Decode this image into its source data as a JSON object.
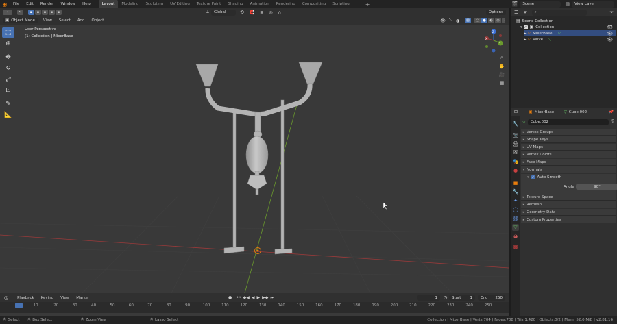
{
  "topbar": {
    "menus": [
      "File",
      "Edit",
      "Render",
      "Window",
      "Help"
    ],
    "workspaces": [
      "Layout",
      "Modeling",
      "Sculpting",
      "UV Editing",
      "Texture Paint",
      "Shading",
      "Animation",
      "Rendering",
      "Compositing",
      "Scripting"
    ],
    "active_workspace": "Layout",
    "scene": "Scene",
    "view_layer": "View Layer"
  },
  "viewport_header": {
    "orientation": "Global",
    "options": "Options"
  },
  "tool_header": {
    "mode": "Object Mode",
    "menus": [
      "View",
      "Select",
      "Add",
      "Object"
    ]
  },
  "viewport": {
    "overlay_title": "User Perspective",
    "overlay_sub": "(1) Collection | MixerBase",
    "axis_labels": {
      "x": "X",
      "y": "Y",
      "z": "Z"
    }
  },
  "outliner": {
    "root": "Scene Collection",
    "collection": "Collection",
    "objects": [
      "MixerBase",
      "Valve"
    ]
  },
  "properties": {
    "object_name": "MixerBase",
    "mesh_name": "Cube.002",
    "mesh_field": "Cube.002",
    "panels_top": [
      "Vertex Groups",
      "Shape Keys",
      "UV Maps",
      "Vertex Colors",
      "Face Maps",
      "Normals"
    ],
    "auto_smooth": "Auto Smooth",
    "angle_label": "Angle",
    "angle_value": "90°",
    "panels_bottom": [
      "Texture Space",
      "Remesh",
      "Geometry Data",
      "Custom Properties"
    ]
  },
  "timeline": {
    "menus": [
      "Playback",
      "Keying",
      "View",
      "Marker"
    ],
    "current_frame": "1",
    "start_label": "Start",
    "start": "1",
    "end_label": "End",
    "end": "250",
    "ticks": [
      "1",
      "10",
      "20",
      "30",
      "40",
      "50",
      "60",
      "70",
      "80",
      "90",
      "100",
      "110",
      "120",
      "130",
      "140",
      "150",
      "160",
      "170",
      "180",
      "190",
      "200",
      "210",
      "220",
      "230",
      "240",
      "250"
    ]
  },
  "status": {
    "select": "Select",
    "box_select": "Box Select",
    "zoom_view": "Zoom View",
    "lasso_select": "Lasso Select",
    "stats": "Collection | MixerBase | Verts:704 | Faces:708 | Tris:1,420 | Objects:0/2 | Mem: 52.0 MiB | v2.81.16"
  },
  "colors": {
    "accent": "#4772b3",
    "x_axis": "#9b3a3a",
    "y_axis": "#6a9a2d",
    "z_axis": "#3b6fd4",
    "mesh": "#b4b4b4",
    "orange": "#e87d0d"
  }
}
